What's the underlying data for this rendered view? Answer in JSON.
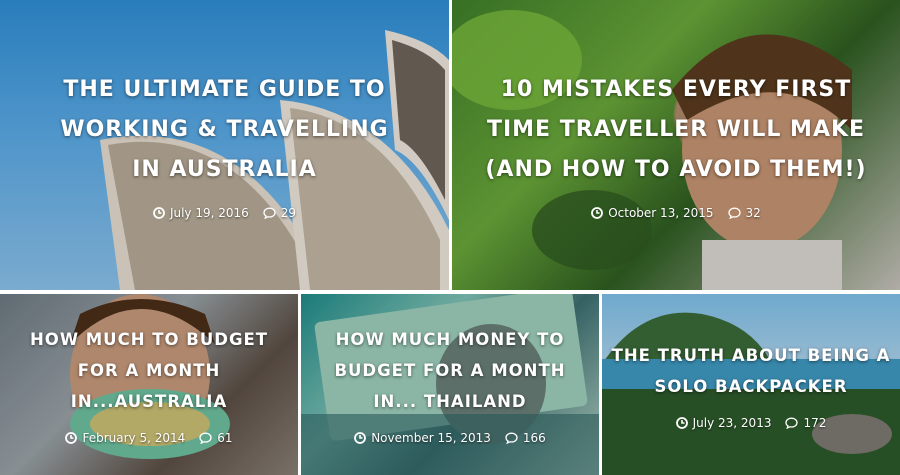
{
  "posts": [
    {
      "title": "THE ULTIMATE GUIDE TO WORKING & TRAVELLING IN AUSTRALIA",
      "date": "July 19, 2016",
      "comments": "29"
    },
    {
      "title": "10 MISTAKES EVERY FIRST TIME TRAVELLER WILL MAKE (AND HOW TO AVOID THEM!)",
      "date": "October 13, 2015",
      "comments": "32"
    },
    {
      "title": "HOW MUCH TO BUDGET FOR A MONTH IN...AUSTRALIA",
      "date": "February 5, 2014",
      "comments": "61"
    },
    {
      "title": "HOW MUCH MONEY TO BUDGET FOR A MONTH IN... THAILAND",
      "date": "November 15, 2013",
      "comments": "166"
    },
    {
      "title": "THE TRUTH ABOUT BEING A SOLO BACKPACKER",
      "date": "July 23, 2013",
      "comments": "172"
    }
  ]
}
